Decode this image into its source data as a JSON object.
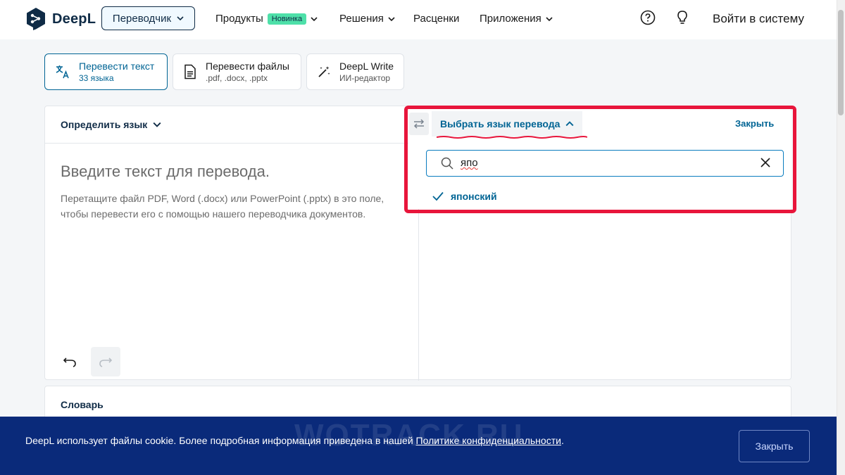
{
  "header": {
    "logo_text": "DeepL",
    "translator_label": "Переводчик",
    "nav": {
      "products": "Продукты",
      "products_badge": "Новинка",
      "solutions": "Решения",
      "pricing": "Расценки",
      "apps": "Приложения"
    },
    "login": "Войти в систему"
  },
  "modes": [
    {
      "title": "Перевести текст",
      "subtitle": "33 языка"
    },
    {
      "title": "Перевести файлы",
      "subtitle": ".pdf, .docx, .pptx"
    },
    {
      "title": "DeepL Write",
      "subtitle": "ИИ-редактор"
    }
  ],
  "source": {
    "detect_label": "Определить язык",
    "placeholder_title": "Введите текст для перевода.",
    "placeholder_hint": "Перетащите файл PDF, Word (.docx) или PowerPoint (.pptx) в это поле, чтобы перевести его с помощью нашего переводчика документов."
  },
  "target": {
    "select_label": "Выбрать язык перевода",
    "close_label": "Закрыть",
    "search_value": "япо",
    "results": [
      "японский"
    ]
  },
  "glossary": {
    "label": "Словарь"
  },
  "cookie": {
    "text_before": "DeepL использует файлы cookie. Более подробная информация приведена в нашей ",
    "link": "Политике конфиденциальности",
    "text_after": ".",
    "button": "Закрыть"
  },
  "watermark": "WOTRACK.RU",
  "colors": {
    "brand_navy": "#0f2b46",
    "accent_blue": "#006494",
    "badge_green": "#4ee0a9",
    "highlight_red": "#e8153b",
    "cookie_bg": "#0a2a7a"
  }
}
